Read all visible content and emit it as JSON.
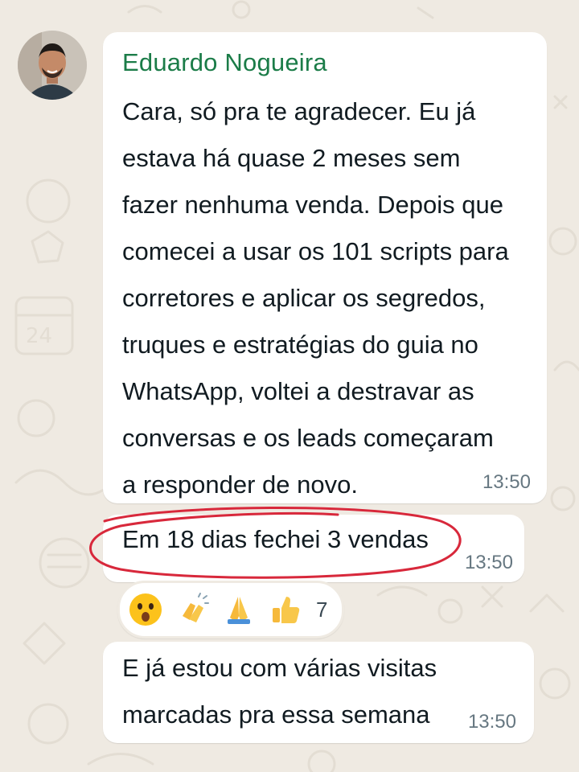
{
  "chat": {
    "sender_name": "Eduardo Nogueira",
    "messages": [
      {
        "text": "Cara, só pra te agradecer. Eu já\nestava há quase 2 meses sem\nfazer nenhuma venda. Depois que\ncomecei a usar os 101 scripts para\ncorretores e aplicar os segredos,\ntruques e estratégias do guia no\nWhatsApp, voltei a destravar as\nconversas e os leads começaram\na responder de novo.",
        "time": "13:50"
      },
      {
        "text": "Em 18 dias fechei 3 vendas",
        "time": "13:50",
        "highlighted": true
      },
      {
        "text": "E já estou com várias visitas\nmarcadas pra essa semana",
        "time": "13:50"
      }
    ],
    "reactions": {
      "icons": [
        "astonished-face-icon",
        "clapping-hands-icon",
        "folded-hands-icon",
        "thumbs-up-icon"
      ],
      "count": "7"
    }
  },
  "colors": {
    "background": "#efeae2",
    "sender_name": "#1b7c48",
    "highlight_circle": "#d8283b",
    "timestamp": "#667781"
  }
}
